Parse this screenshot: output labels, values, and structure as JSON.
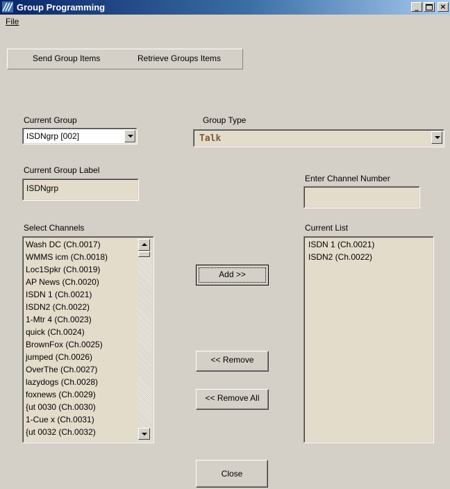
{
  "window": {
    "title": "Group Programming"
  },
  "menu": {
    "file": "File"
  },
  "tabs": [
    {
      "label": "Send Group Items"
    },
    {
      "label": "Retrieve Groups Items"
    }
  ],
  "current_group": {
    "label": "Current Group",
    "value": "ISDNgrp  [002]"
  },
  "group_type": {
    "label": "Group Type",
    "value": "Talk"
  },
  "current_group_label": {
    "label": "Current Group Label",
    "value": "ISDNgrp"
  },
  "channel_number": {
    "label": "Enter Channel Number",
    "value": ""
  },
  "select_channels": {
    "label": "Select Channels",
    "items": [
      "Wash DC (Ch.0017)",
      "WMMS icm (Ch.0018)",
      "Loc1Spkr (Ch.0019)",
      "AP News (Ch.0020)",
      "ISDN 1 (Ch.0021)",
      "ISDN2 (Ch.0022)",
      "1-Mtr 4  (Ch.0023)",
      "quick (Ch.0024)",
      "BrownFox (Ch.0025)",
      "jumped (Ch.0026)",
      "OverThe (Ch.0027)",
      "lazydogs (Ch.0028)",
      "foxnews (Ch.0029)",
      "{ut 0030 (Ch.0030)",
      "1-Cue x  (Ch.0031)",
      "{ut 0032 (Ch.0032)"
    ]
  },
  "current_list": {
    "label": "Current List",
    "items": [
      "ISDN 1 (Ch.0021)",
      "ISDN2 (Ch.0022)"
    ]
  },
  "buttons": {
    "add": "Add >>",
    "remove": "<< Remove",
    "remove_all": "<< Remove All",
    "close": "Close"
  },
  "colors": {
    "title_start": "#0a246a",
    "title_end": "#a6caf0",
    "field": "#e4dccb",
    "face": "#d4d0c8",
    "group_type_text": "#7a5a3a"
  }
}
